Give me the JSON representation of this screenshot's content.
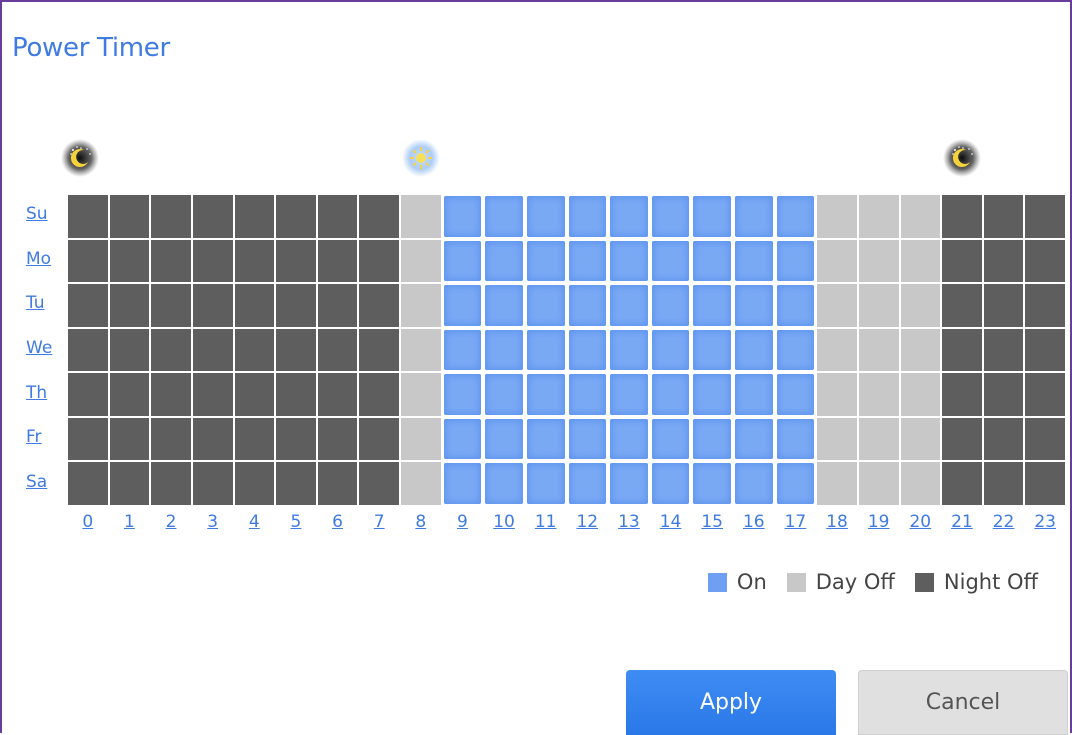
{
  "title": "Power Timer",
  "days": [
    {
      "label": "Su"
    },
    {
      "label": "Mo"
    },
    {
      "label": "Tu"
    },
    {
      "label": "We"
    },
    {
      "label": "Th"
    },
    {
      "label": "Fr"
    },
    {
      "label": "Sa"
    }
  ],
  "hours": [
    "0",
    "1",
    "2",
    "3",
    "4",
    "5",
    "6",
    "7",
    "8",
    "9",
    "10",
    "11",
    "12",
    "13",
    "14",
    "15",
    "16",
    "17",
    "18",
    "19",
    "20",
    "21",
    "22",
    "23"
  ],
  "schedule_by_hour": [
    "night",
    "night",
    "night",
    "night",
    "night",
    "night",
    "night",
    "night",
    "day",
    "on",
    "on",
    "on",
    "on",
    "on",
    "on",
    "on",
    "on",
    "on",
    "day",
    "day",
    "day",
    "night",
    "night",
    "night"
  ],
  "period_icons": [
    {
      "name": "moon-icon",
      "at_hour": 0
    },
    {
      "name": "sun-icon",
      "at_hour": 8
    },
    {
      "name": "moon-icon",
      "at_hour": 21
    }
  ],
  "legend": {
    "on": "On",
    "day_off": "Day Off",
    "night_off": "Night Off"
  },
  "colors": {
    "on": "#7aa9f4",
    "day_off": "#c8c8c8",
    "night_off": "#5e5e5e",
    "accent": "#3f7be0"
  },
  "buttons": {
    "apply": "Apply",
    "cancel": "Cancel"
  }
}
